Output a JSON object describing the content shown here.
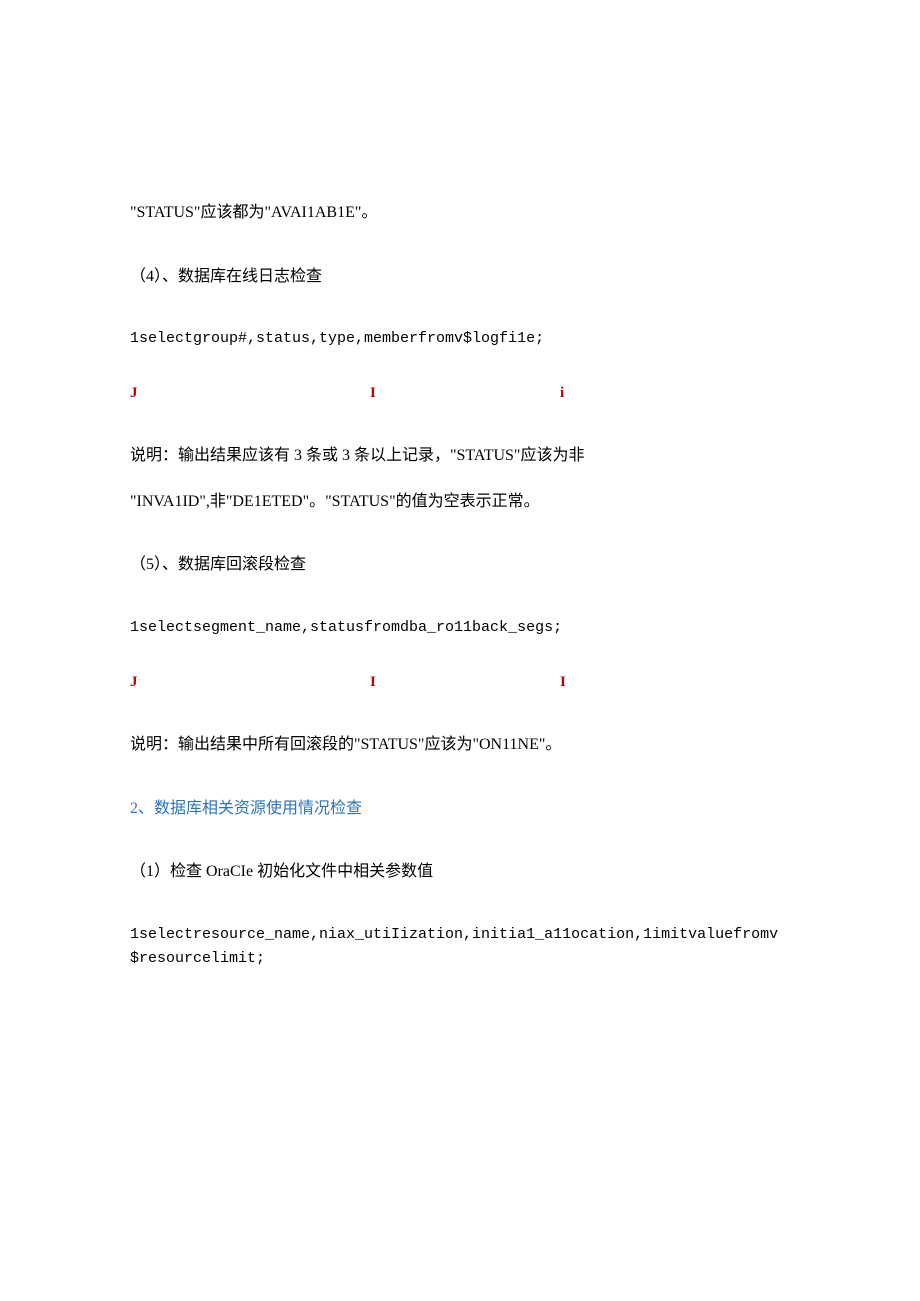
{
  "p1": "\"STATUS\"应该都为\"AVAI1AB1E\"。",
  "p2": "（4）、数据库在线日志检查",
  "code1": "1selectgroup#,status,type,memberfromv$logfi1e;",
  "marker1": {
    "a": "J",
    "b": "I",
    "c": "i"
  },
  "p3": "说明：输出结果应该有 3 条或 3 条以上记录，\"STATUS\"应该为非",
  "p4": "\"INVA1ID\",非\"DE1ETED\"。\"STATUS\"的值为空表示正常。",
  "p5": "（5）、数据库回滚段检查",
  "code2": "1selectsegment_name,statusfromdba_ro11back_segs;",
  "marker2": {
    "a": "J",
    "b": "I",
    "c": "I"
  },
  "p6": "说明：输出结果中所有回滚段的\"STATUS\"应该为\"ON11NE\"。",
  "heading": "2、数据库相关资源使用情况检查",
  "p7": "（1）检查 OraCIe 初始化文件中相关参数值",
  "code3": "1selectresource_name,niax_utiIization,initia1_a11ocation,1imitvaluefromv$resourcelimit;"
}
